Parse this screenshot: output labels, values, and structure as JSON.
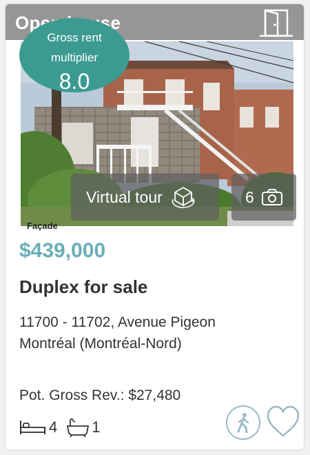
{
  "banner": {
    "text": "Open house",
    "icon": "door-icon"
  },
  "grm": {
    "label_line1": "Gross rent",
    "label_line2": "multiplier",
    "value": "8.0"
  },
  "photo": {
    "caption": "Façade"
  },
  "buttons": {
    "virtual_tour_label": "Virtual tour",
    "virtual_tour_icon": "cube-360-icon",
    "photo_count": "6",
    "photo_icon": "camera-icon"
  },
  "listing": {
    "price": "$439,000",
    "type": "Duplex for sale",
    "address_line1": "11700 - 11702, Avenue Pigeon",
    "address_line2": "Montréal (Montréal-Nord)",
    "revenue": "Pot. Gross Rev.: $27,480",
    "bedrooms": "4",
    "bathrooms": "1"
  },
  "actions": {
    "walk_icon": "pedestrian-icon",
    "favorite_icon": "heart-icon"
  },
  "colors": {
    "price": "#6aaeb7",
    "badge": "#3b9b90",
    "overlay": "#5f5f5f"
  }
}
